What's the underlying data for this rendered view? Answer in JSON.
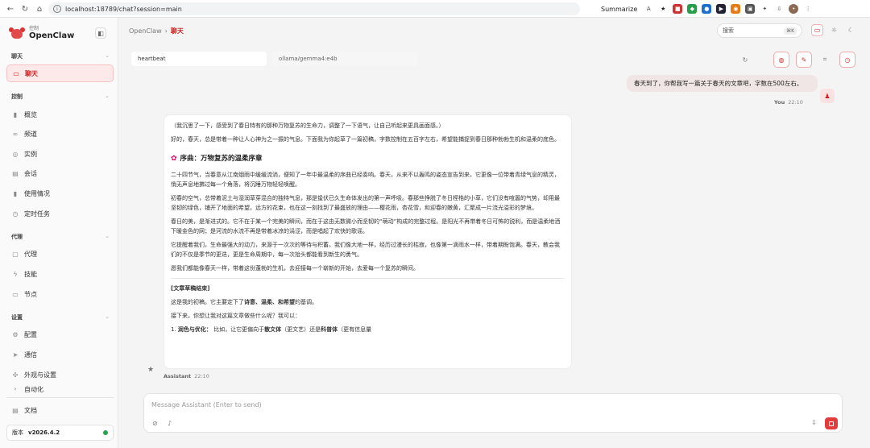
{
  "browser": {
    "url": "localhost:18789/chat?session=main",
    "summarize_label": "Summarize"
  },
  "sidebar": {
    "brand_small": "控制",
    "brand_name": "OpenClaw",
    "sections": [
      {
        "title": "聊天",
        "items": [
          {
            "label": "聊天",
            "icon": "chat-icon"
          }
        ]
      },
      {
        "title": "控制",
        "items": [
          {
            "label": "概览",
            "icon": "bar-chart-icon"
          },
          {
            "label": "频道",
            "icon": "link-icon"
          },
          {
            "label": "实例",
            "icon": "radio-icon"
          },
          {
            "label": "会话",
            "icon": "document-icon"
          },
          {
            "label": "使用情况",
            "icon": "bar-chart-icon"
          },
          {
            "label": "定时任务",
            "icon": "clock-icon"
          }
        ]
      },
      {
        "title": "代理",
        "items": [
          {
            "label": "代理",
            "icon": "folder-icon"
          },
          {
            "label": "技能",
            "icon": "zap-icon"
          },
          {
            "label": "节点",
            "icon": "monitor-icon"
          }
        ]
      },
      {
        "title": "设置",
        "items": [
          {
            "label": "配置",
            "icon": "gear-icon"
          },
          {
            "label": "通信",
            "icon": "send-icon"
          },
          {
            "label": "外观与设置",
            "icon": "sparkle-icon"
          },
          {
            "label": "自动化",
            "icon": "automation-icon"
          }
        ]
      }
    ],
    "docs_label": "文档",
    "version_label": "版本",
    "version_value": "v2026.4.2",
    "status_color": "#2ca24c"
  },
  "header": {
    "breadcrumb_root": "OpenClaw",
    "breadcrumb_current": "聊天",
    "search_placeholder": "搜索",
    "search_shortcut": "⌘K"
  },
  "toolbar": {
    "session_label": "heartbeat",
    "model_label": "ollama/gemma4:e4b"
  },
  "messages": {
    "user": {
      "text": "春天到了，你帮我写一篇关于春天的文章吧，字数在500左右。",
      "sender": "You",
      "time": "22:10"
    },
    "assistant": {
      "intro": "（我沉思了一下，感受到了春日特有的那种万物复苏的生命力，调整了一下语气，让自己听起来更具画面感。）",
      "p1": "好的，春天，总是带着一种让人心神为之一振的气息。下面我为你起草了一篇初稿，字数控制在五百字左右，希望能捕捉到春日那种勃勃生机和温柔的底色。",
      "heading": "序曲：万物复苏的温柔序章",
      "p2": "二十四节气，当春意从江南烟雨中缓缓流淌，便知了一年中最温柔的序曲已经奏响。春天，从来不以轰鸣的姿态宣告到来，它更像一位带着青绿气息的精灵，悄无声息地拂过每一个角落，将沉睡万物轻轻唤醒。",
      "p3": "初春的空气，总带着泥土与湿润草芽混合的独特气息，那是蛰伏已久生命体发出的第一声呼吸。春那些挣脱了冬日桎梏的小草，它们没有喧嚣的气势，却用最坚韧的绿色，铺开了地面的希望。远方的花束，也在这一刻找到了最盛放的理由——樱花雨，杏花雪，和迎春的嫩黄，汇聚成一片流光溢彩的梦境。",
      "p4": "春日的美，是渐进式的。它不在于某一个完美的瞬间，而在于这由无数微小而坚韧的“萌动”构成的完整过程。是阳光不再带着冬日可怖的锐利，而是温柔地洒下暖金色的网；是河流的水流不再是带着冰凉的涓涩，而是唱起了欢快的歌谣。",
      "p5": "它提醒着我们，生命最强大的动力，来源于一次次的等待与积蓄。我们像大地一样，经历过漫长的枯寂，也像第一滴雨水一样，带着期盼饱满。春天，教会我们的不仅是季节的更迭，更是生命周期中，每一次抬头都能看到新生的勇气。",
      "p6": "愿我们都能像春天一样，带着这份蓬勃的生机，去迎接每一个崭新的开始，去爱每一个复苏的瞬间。",
      "draft_end": "[文章草稿结束]",
      "summary_prefix": "这是我的初稿。它主要定下了",
      "summary_bold": "诗意、温柔、和希望",
      "summary_suffix": "的基调。",
      "followup": "接下来，你想让我对这篇文章做些什么呢？我可以：",
      "item1_prefix": "1. ",
      "item1_bold": "润色与优化：",
      "item1_text": "比如，让它更偏向于",
      "item1_bold2": "散文体",
      "item1_text2": "（更文艺）还是",
      "item1_bold3": "科普体",
      "item1_text3": "（更有信息量",
      "sender": "Assistant",
      "time": "22:10"
    }
  },
  "composer": {
    "placeholder": "Message Assistant (Enter to send)"
  }
}
